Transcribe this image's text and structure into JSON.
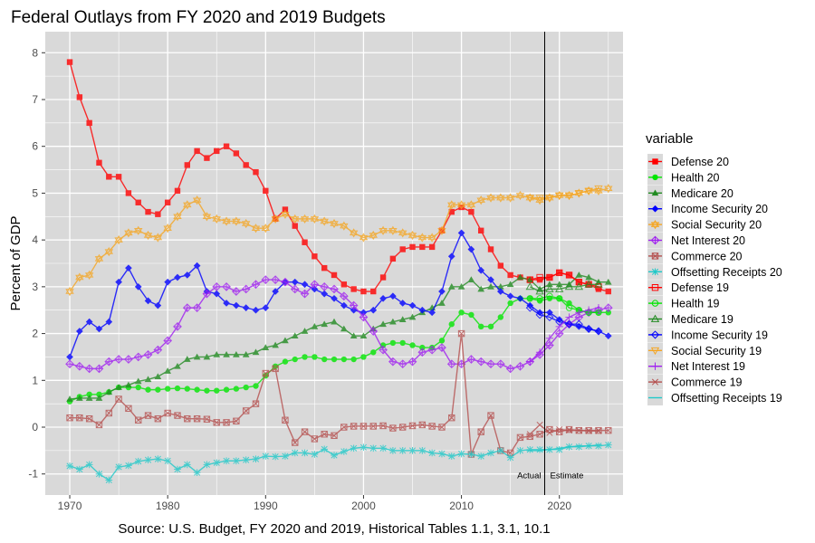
{
  "chart_data": {
    "type": "line",
    "title": "Federal Outlays from FY 2020 and 2019 Budgets",
    "xlabel": "Source: U.S. Budget, FY 2020 and 2019, Historical Tables 1.1, 3.1, 10.1",
    "ylabel": "Percent of GDP",
    "xlim": [
      1967.5,
      2026.5
    ],
    "ylim": [
      -1.45,
      8.45
    ],
    "x_ticks": [
      1970,
      1980,
      1990,
      2000,
      2010,
      2020
    ],
    "y_ticks": [
      -1,
      0,
      1,
      2,
      3,
      4,
      5,
      6,
      7,
      8
    ],
    "grid": true,
    "legend_title": "variable",
    "legend_position": "right",
    "vline": {
      "x": 2018.5,
      "left_label": "Actual",
      "right_label": "Estimate"
    },
    "series": [
      {
        "name": "Defense 20",
        "color": "#ff0000",
        "marker": "square-filled",
        "x_start": 1970,
        "values": [
          7.8,
          7.05,
          6.5,
          5.65,
          5.35,
          5.35,
          5.0,
          4.8,
          4.6,
          4.55,
          4.8,
          5.05,
          5.6,
          5.9,
          5.75,
          5.9,
          6.0,
          5.85,
          5.6,
          5.45,
          5.05,
          4.45,
          4.65,
          4.3,
          3.95,
          3.65,
          3.4,
          3.25,
          3.05,
          2.95,
          2.9,
          2.9,
          3.2,
          3.6,
          3.8,
          3.85,
          3.85,
          3.85,
          4.2,
          4.6,
          4.7,
          4.6,
          4.2,
          3.8,
          3.45,
          3.25,
          3.2,
          3.15,
          3.15,
          3.2,
          3.3,
          3.25,
          3.1,
          3.05,
          2.95,
          2.9
        ]
      },
      {
        "name": "Health 20",
        "color": "#00e600",
        "marker": "circle-filled",
        "x_start": 1970,
        "values": [
          0.55,
          0.65,
          0.7,
          0.7,
          0.75,
          0.85,
          0.85,
          0.85,
          0.8,
          0.8,
          0.82,
          0.83,
          0.82,
          0.8,
          0.78,
          0.78,
          0.8,
          0.82,
          0.85,
          0.88,
          1.1,
          1.3,
          1.4,
          1.45,
          1.5,
          1.5,
          1.45,
          1.45,
          1.45,
          1.45,
          1.5,
          1.6,
          1.75,
          1.8,
          1.8,
          1.75,
          1.7,
          1.7,
          1.85,
          2.2,
          2.45,
          2.4,
          2.15,
          2.15,
          2.35,
          2.65,
          2.75,
          2.75,
          2.7,
          2.75,
          2.75,
          2.65,
          2.5,
          2.45,
          2.45,
          2.45
        ]
      },
      {
        "name": "Medicare 20",
        "color": "#228b22",
        "marker": "triangle-filled",
        "x_start": 1970,
        "values": [
          0.6,
          0.62,
          0.62,
          0.62,
          0.75,
          0.85,
          0.9,
          0.98,
          1.02,
          1.08,
          1.2,
          1.3,
          1.45,
          1.5,
          1.5,
          1.55,
          1.55,
          1.55,
          1.55,
          1.6,
          1.7,
          1.75,
          1.85,
          1.95,
          2.05,
          2.15,
          2.2,
          2.25,
          2.1,
          1.95,
          1.95,
          2.1,
          2.2,
          2.25,
          2.3,
          2.35,
          2.45,
          2.55,
          2.65,
          3.0,
          3.0,
          3.15,
          2.95,
          3.0,
          3.0,
          3.05,
          3.2,
          3.15,
          2.95,
          3.05,
          3.05,
          3.05,
          3.25,
          3.2,
          3.1,
          3.1
        ]
      },
      {
        "name": "Income Security 20",
        "color": "#0000ff",
        "marker": "diamond-filled",
        "x_start": 1970,
        "values": [
          1.5,
          2.05,
          2.25,
          2.1,
          2.25,
          3.1,
          3.4,
          3.0,
          2.7,
          2.6,
          3.1,
          3.2,
          3.25,
          3.45,
          2.9,
          2.85,
          2.65,
          2.6,
          2.55,
          2.5,
          2.55,
          2.9,
          3.1,
          3.1,
          3.05,
          2.95,
          2.85,
          2.75,
          2.6,
          2.5,
          2.45,
          2.5,
          2.75,
          2.8,
          2.65,
          2.6,
          2.5,
          2.45,
          2.9,
          3.65,
          4.15,
          3.8,
          3.35,
          3.15,
          2.9,
          2.8,
          2.75,
          2.6,
          2.45,
          2.45,
          2.3,
          2.2,
          2.15,
          2.1,
          2.05,
          1.95
        ]
      },
      {
        "name": "Social Security 20",
        "color": "#f5a623",
        "marker": "star-of-david",
        "x_start": 1970,
        "values": [
          2.9,
          3.2,
          3.25,
          3.6,
          3.75,
          4.0,
          4.15,
          4.2,
          4.1,
          4.05,
          4.25,
          4.5,
          4.75,
          4.85,
          4.5,
          4.45,
          4.4,
          4.4,
          4.35,
          4.25,
          4.25,
          4.45,
          4.55,
          4.45,
          4.45,
          4.45,
          4.4,
          4.35,
          4.3,
          4.15,
          4.05,
          4.1,
          4.2,
          4.2,
          4.15,
          4.1,
          4.05,
          4.05,
          4.2,
          4.75,
          4.75,
          4.75,
          4.85,
          4.9,
          4.9,
          4.9,
          4.95,
          4.9,
          4.85,
          4.9,
          4.95,
          4.95,
          5.0,
          5.05,
          5.05,
          5.1
        ]
      },
      {
        "name": "Net Interest 20",
        "color": "#a020f0",
        "marker": "diamond-plus",
        "x_start": 1970,
        "values": [
          1.35,
          1.3,
          1.25,
          1.25,
          1.4,
          1.45,
          1.45,
          1.5,
          1.55,
          1.65,
          1.85,
          2.15,
          2.55,
          2.55,
          2.85,
          3.0,
          3.0,
          2.9,
          2.95,
          3.05,
          3.15,
          3.15,
          3.1,
          2.95,
          2.85,
          3.05,
          3.0,
          2.95,
          2.8,
          2.6,
          2.35,
          2.05,
          1.65,
          1.4,
          1.35,
          1.4,
          1.6,
          1.65,
          1.7,
          1.35,
          1.35,
          1.45,
          1.4,
          1.35,
          1.35,
          1.25,
          1.3,
          1.4,
          1.55,
          1.75,
          2.0,
          2.2,
          2.35,
          2.45,
          2.5,
          2.55
        ]
      },
      {
        "name": "Commerce 20",
        "color": "#b5504f",
        "marker": "square-x",
        "x_start": 1970,
        "values": [
          0.2,
          0.2,
          0.18,
          0.05,
          0.3,
          0.6,
          0.4,
          0.15,
          0.25,
          0.18,
          0.3,
          0.25,
          0.18,
          0.18,
          0.17,
          0.1,
          0.1,
          0.13,
          0.35,
          0.5,
          1.15,
          1.25,
          0.15,
          -0.33,
          -0.1,
          -0.25,
          -0.15,
          -0.18,
          0.0,
          0.02,
          0.02,
          0.02,
          0.03,
          -0.02,
          0.0,
          0.03,
          0.05,
          0.02,
          0.0,
          0.2,
          2.0,
          -0.58,
          -0.1,
          0.25,
          -0.5,
          -0.55,
          -0.22,
          -0.2,
          -0.15,
          -0.05,
          -0.1,
          -0.05,
          -0.07,
          -0.07,
          -0.07,
          -0.07
        ]
      },
      {
        "name": "Offsetting Receipts 20",
        "color": "#20c9c9",
        "marker": "asterisk",
        "x_start": 1970,
        "values": [
          -0.83,
          -0.9,
          -0.8,
          -1.0,
          -1.13,
          -0.85,
          -0.82,
          -0.73,
          -0.7,
          -0.68,
          -0.72,
          -0.9,
          -0.8,
          -0.97,
          -0.8,
          -0.76,
          -0.72,
          -0.72,
          -0.7,
          -0.68,
          -0.62,
          -0.63,
          -0.62,
          -0.55,
          -0.55,
          -0.58,
          -0.47,
          -0.6,
          -0.52,
          -0.45,
          -0.43,
          -0.45,
          -0.45,
          -0.5,
          -0.5,
          -0.5,
          -0.5,
          -0.55,
          -0.57,
          -0.62,
          -0.57,
          -0.58,
          -0.62,
          -0.55,
          -0.5,
          -0.65,
          -0.5,
          -0.48,
          -0.48,
          -0.48,
          -0.48,
          -0.42,
          -0.42,
          -0.4,
          -0.4,
          -0.38
        ]
      },
      {
        "name": "Defense 19",
        "color": "#ff0000",
        "marker": "square-open",
        "x_start": 2017,
        "values": [
          3.15,
          3.2,
          3.2,
          3.3,
          3.25,
          3.1,
          3.05,
          3.0
        ]
      },
      {
        "name": "Health 19",
        "color": "#00e600",
        "marker": "circle-open",
        "x_start": 2017,
        "values": [
          2.75,
          2.75,
          2.8,
          2.75,
          2.55,
          2.5,
          2.45,
          2.45
        ]
      },
      {
        "name": "Medicare 19",
        "color": "#228b22",
        "marker": "triangle-open",
        "x_start": 2017,
        "values": [
          3.0,
          2.9,
          2.95,
          2.95,
          3.0,
          3.0,
          3.05,
          3.05
        ]
      },
      {
        "name": "Income Security 19",
        "color": "#0000ff",
        "marker": "diamond-open",
        "x_start": 2017,
        "values": [
          2.55,
          2.4,
          2.35,
          2.25,
          2.2,
          2.2,
          2.1,
          2.05
        ]
      },
      {
        "name": "Social Security 19",
        "color": "#f5a623",
        "marker": "triangle-down-open",
        "x_start": 2017,
        "values": [
          4.9,
          4.9,
          4.9,
          4.95,
          4.95,
          5.0,
          5.05,
          5.1
        ]
      },
      {
        "name": "Net Interest 19",
        "color": "#a020f0",
        "marker": "plus",
        "x_start": 2017,
        "values": [
          1.4,
          1.6,
          1.9,
          2.15,
          2.35,
          2.45,
          2.5,
          2.55
        ]
      },
      {
        "name": "Commerce 19",
        "color": "#b5504f",
        "marker": "x",
        "x_start": 2017,
        "values": [
          -0.15,
          0.05,
          -0.12,
          -0.05,
          -0.07,
          -0.07,
          -0.08,
          -0.08
        ]
      },
      {
        "name": "Offsetting Receipts 19",
        "color": "#20c9c9",
        "marker": "dash",
        "x_start": 2017,
        "values": [
          -0.5,
          -0.5,
          -0.48,
          -0.45,
          -0.42,
          -0.4,
          -0.4,
          -0.38
        ]
      }
    ]
  }
}
